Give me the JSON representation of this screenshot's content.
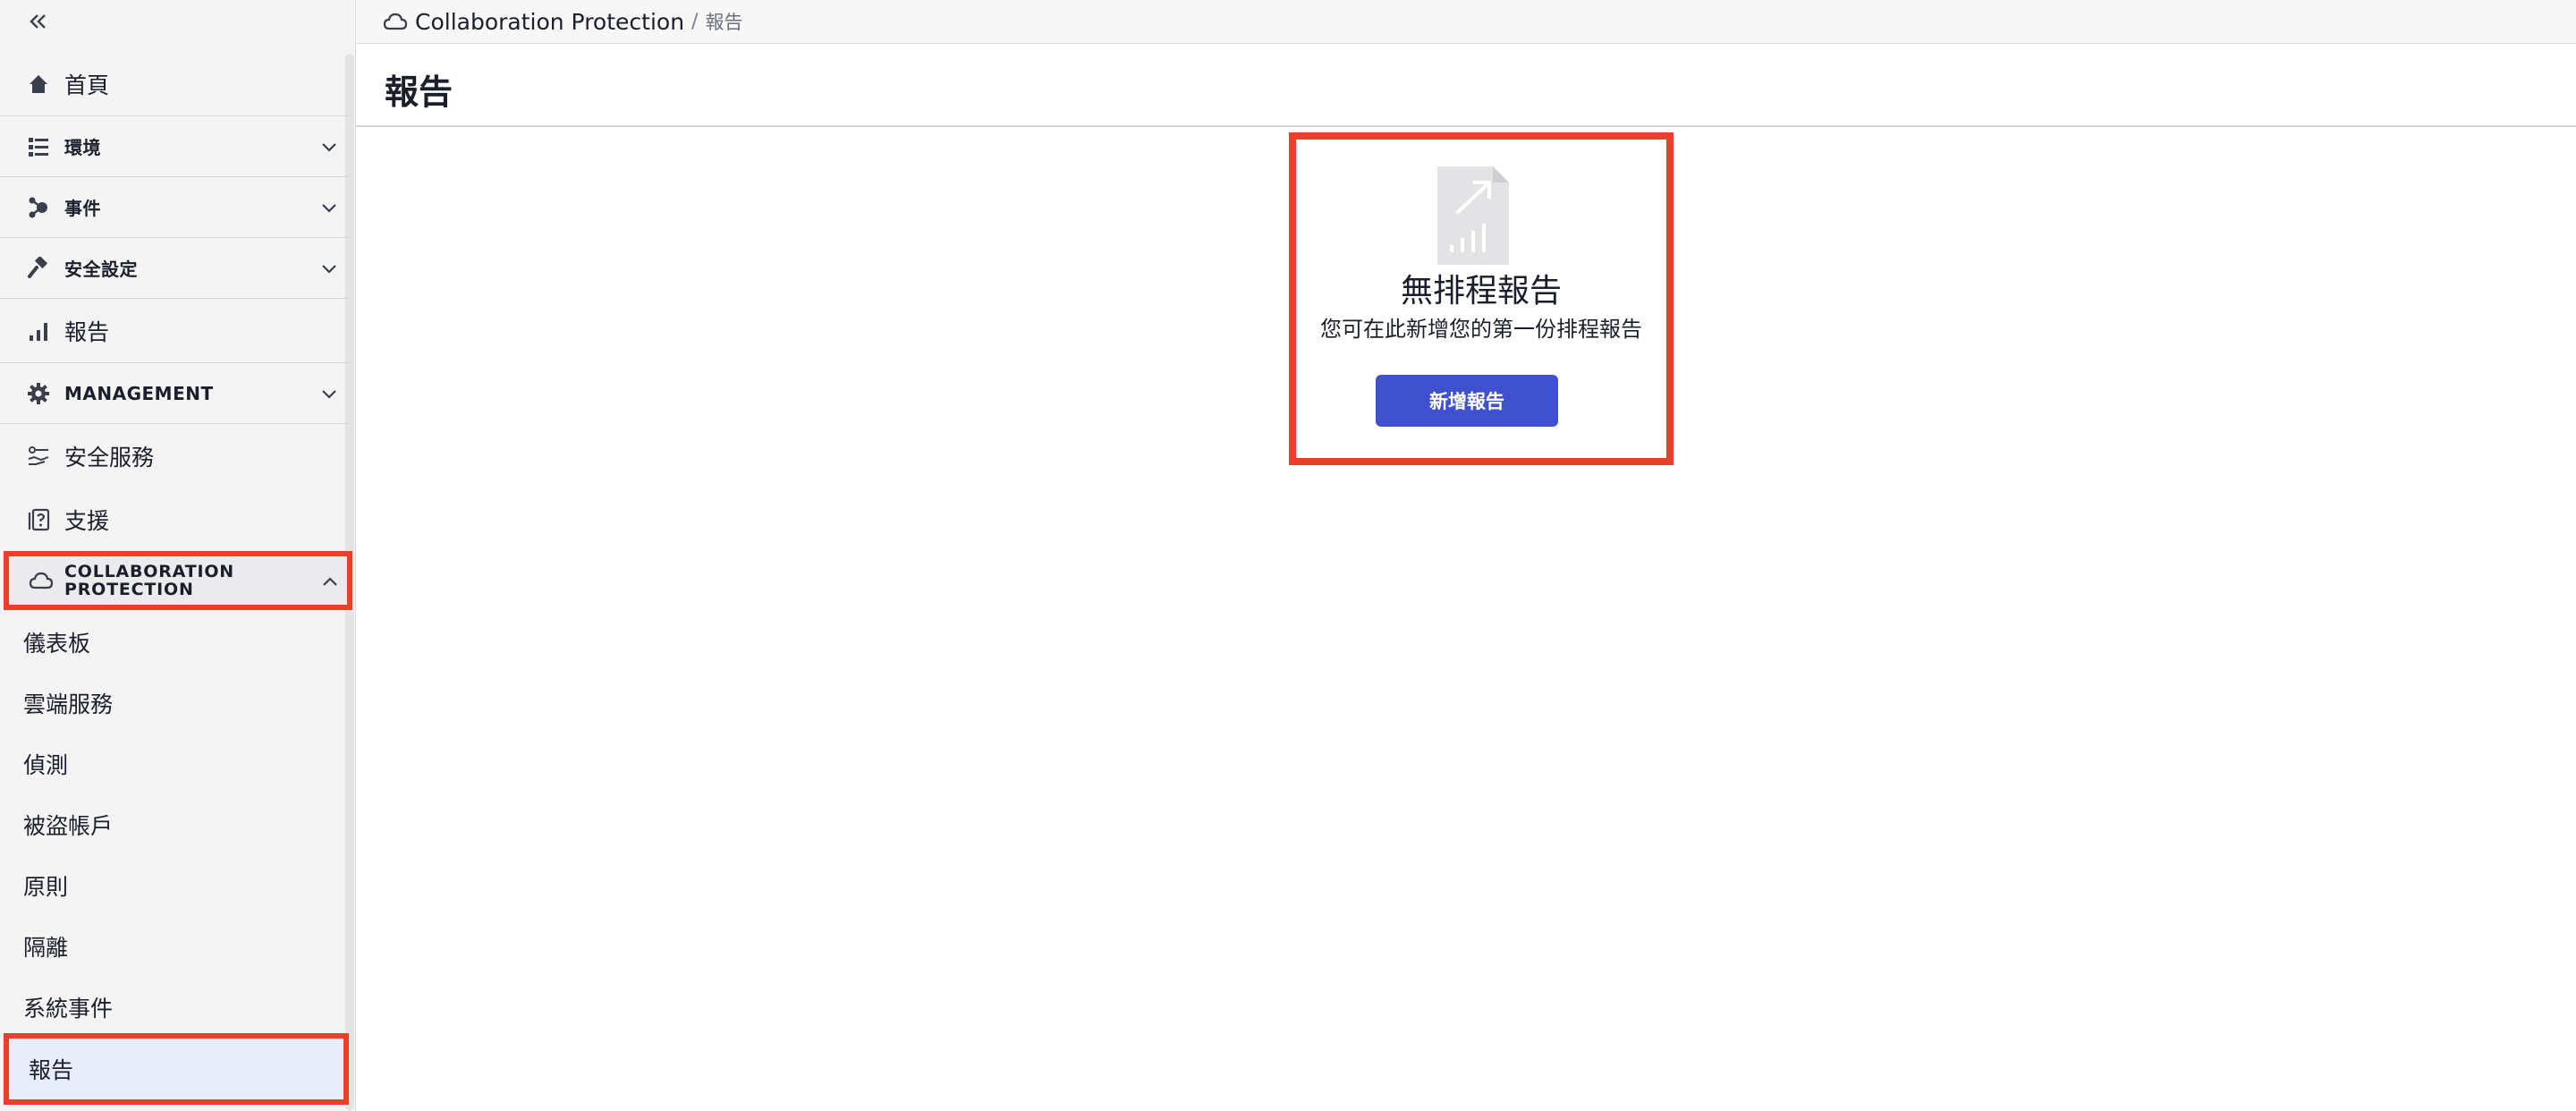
{
  "sidebar": {
    "items": [
      {
        "label": "首頁",
        "icon": "home-icon"
      },
      {
        "label": "環境",
        "icon": "list-icon"
      },
      {
        "label": "事件",
        "icon": "incident-icon"
      },
      {
        "label": "安全設定",
        "icon": "gavel-icon"
      },
      {
        "label": "報告",
        "icon": "bar-chart-icon"
      },
      {
        "label": "MANAGEMENT",
        "icon": "gear-icon"
      },
      {
        "label": "安全服務",
        "icon": "service-icon"
      },
      {
        "label": "支援",
        "icon": "support-icon"
      }
    ],
    "collab_section": {
      "label": "COLLABORATION PROTECTION",
      "icon": "cloud-icon"
    },
    "sub_items": [
      "儀表板",
      "雲端服務",
      "偵測",
      "被盜帳戶",
      "原則",
      "隔離",
      "系統事件",
      "報告"
    ]
  },
  "breadcrumb": {
    "root": "Collaboration Protection",
    "separator": "/",
    "current": "報告"
  },
  "page": {
    "title": "報告"
  },
  "empty_state": {
    "title": "無排程報告",
    "subtitle": "您可在此新增您的第一份排程報告",
    "button": "新增報告"
  },
  "colors": {
    "highlight_border": "#e8402a",
    "primary_button": "#3f51cf",
    "active_item_bg": "#e9ecfb"
  }
}
